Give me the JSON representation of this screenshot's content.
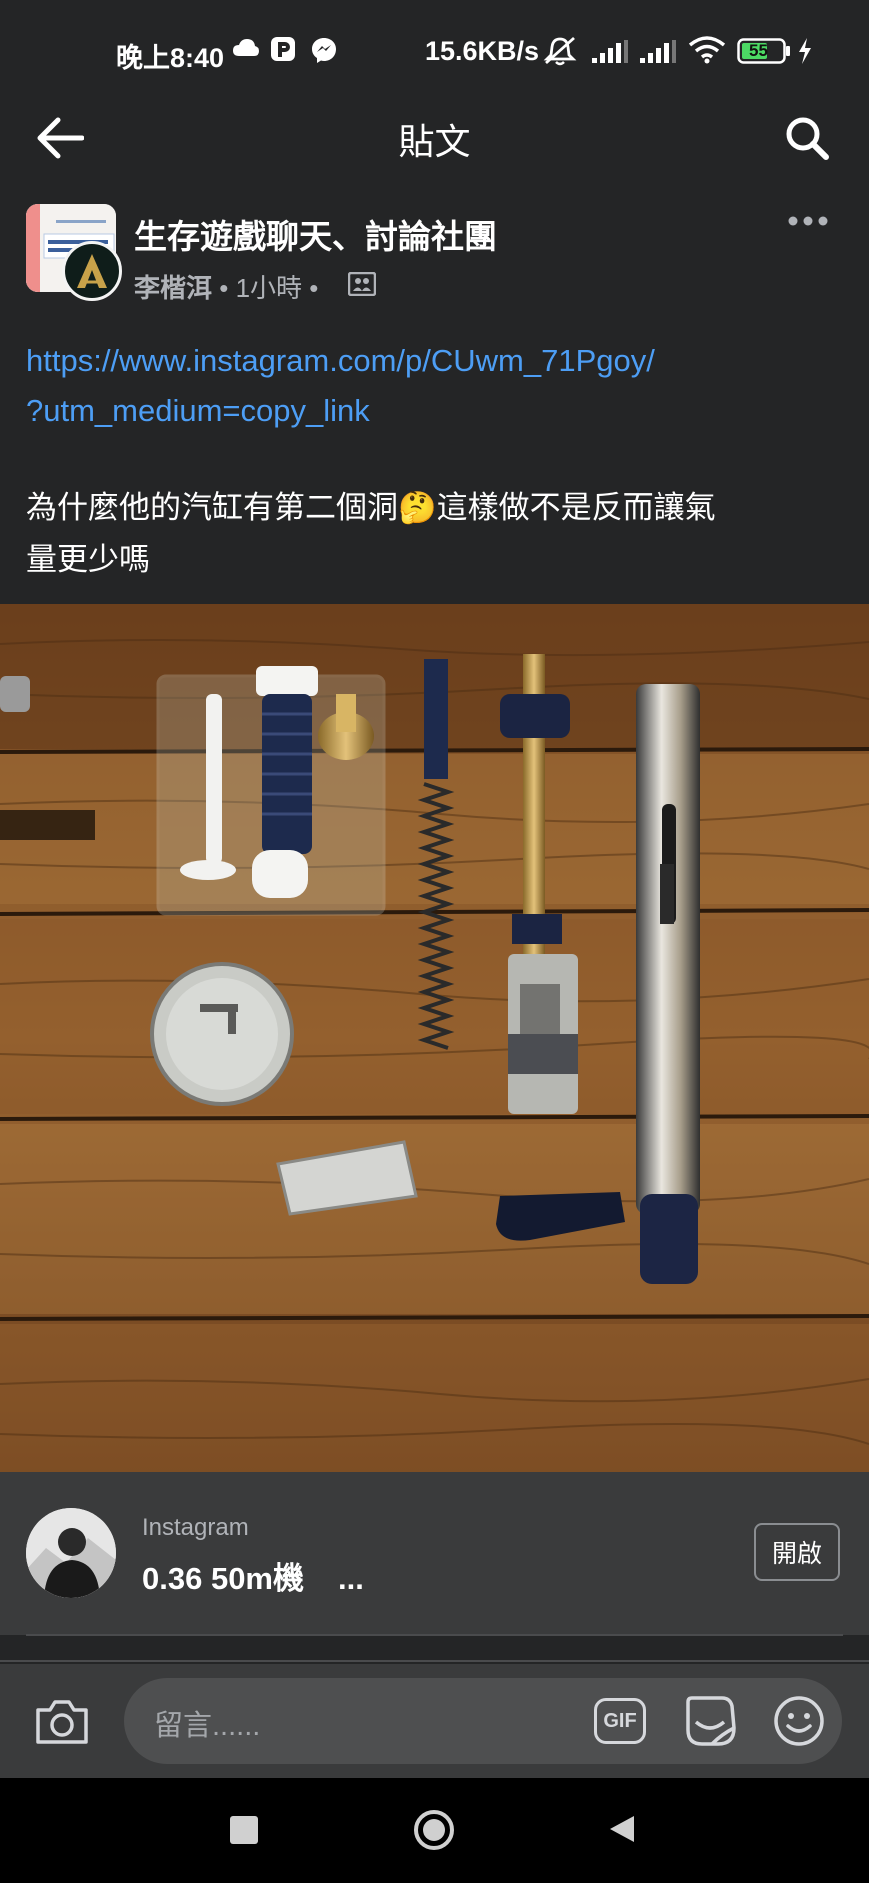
{
  "status_bar": {
    "time": "晚上8:40",
    "network_speed": "15.6KB/s",
    "battery_level": "55",
    "icons": [
      "cloud-icon",
      "p-app-icon",
      "messenger-icon",
      "mute-icon",
      "signal-icon",
      "signal-icon",
      "wifi-icon",
      "battery-icon",
      "charging-icon"
    ]
  },
  "app_bar": {
    "title": "貼文",
    "back_icon": "back-arrow-icon",
    "search_icon": "search-icon"
  },
  "post": {
    "group_name": "生存遊戲聊天、討論社團",
    "author": "李楷洱",
    "time": "1小時",
    "separator": "•",
    "privacy_icon": "group-privacy-icon",
    "more_icon": "more-options-icon",
    "link_line1": "https://www.instagram.com/p/CUwm_71Pgoy/",
    "link_line2": "?utm_medium=copy_link",
    "text_line1_part1": "為什麼他的汽缸有第二個洞",
    "text_line1_emoji": "🤔",
    "text_line1_part2": "這樣做不是反而讓氣",
    "text_line2": "量更少嗎"
  },
  "link_preview": {
    "source": "Instagram",
    "title": "0.36 50m機",
    "ellipsis": "...",
    "open_label": "開啟"
  },
  "comment_bar": {
    "placeholder": "留言......",
    "camera_icon": "camera-icon",
    "gif_label": "GIF",
    "sticker_icon": "sticker-icon",
    "emoji_icon": "emoji-icon"
  },
  "nav_bar": {
    "icons": [
      "recents-square-icon",
      "home-circle-icon",
      "back-triangle-icon"
    ]
  }
}
